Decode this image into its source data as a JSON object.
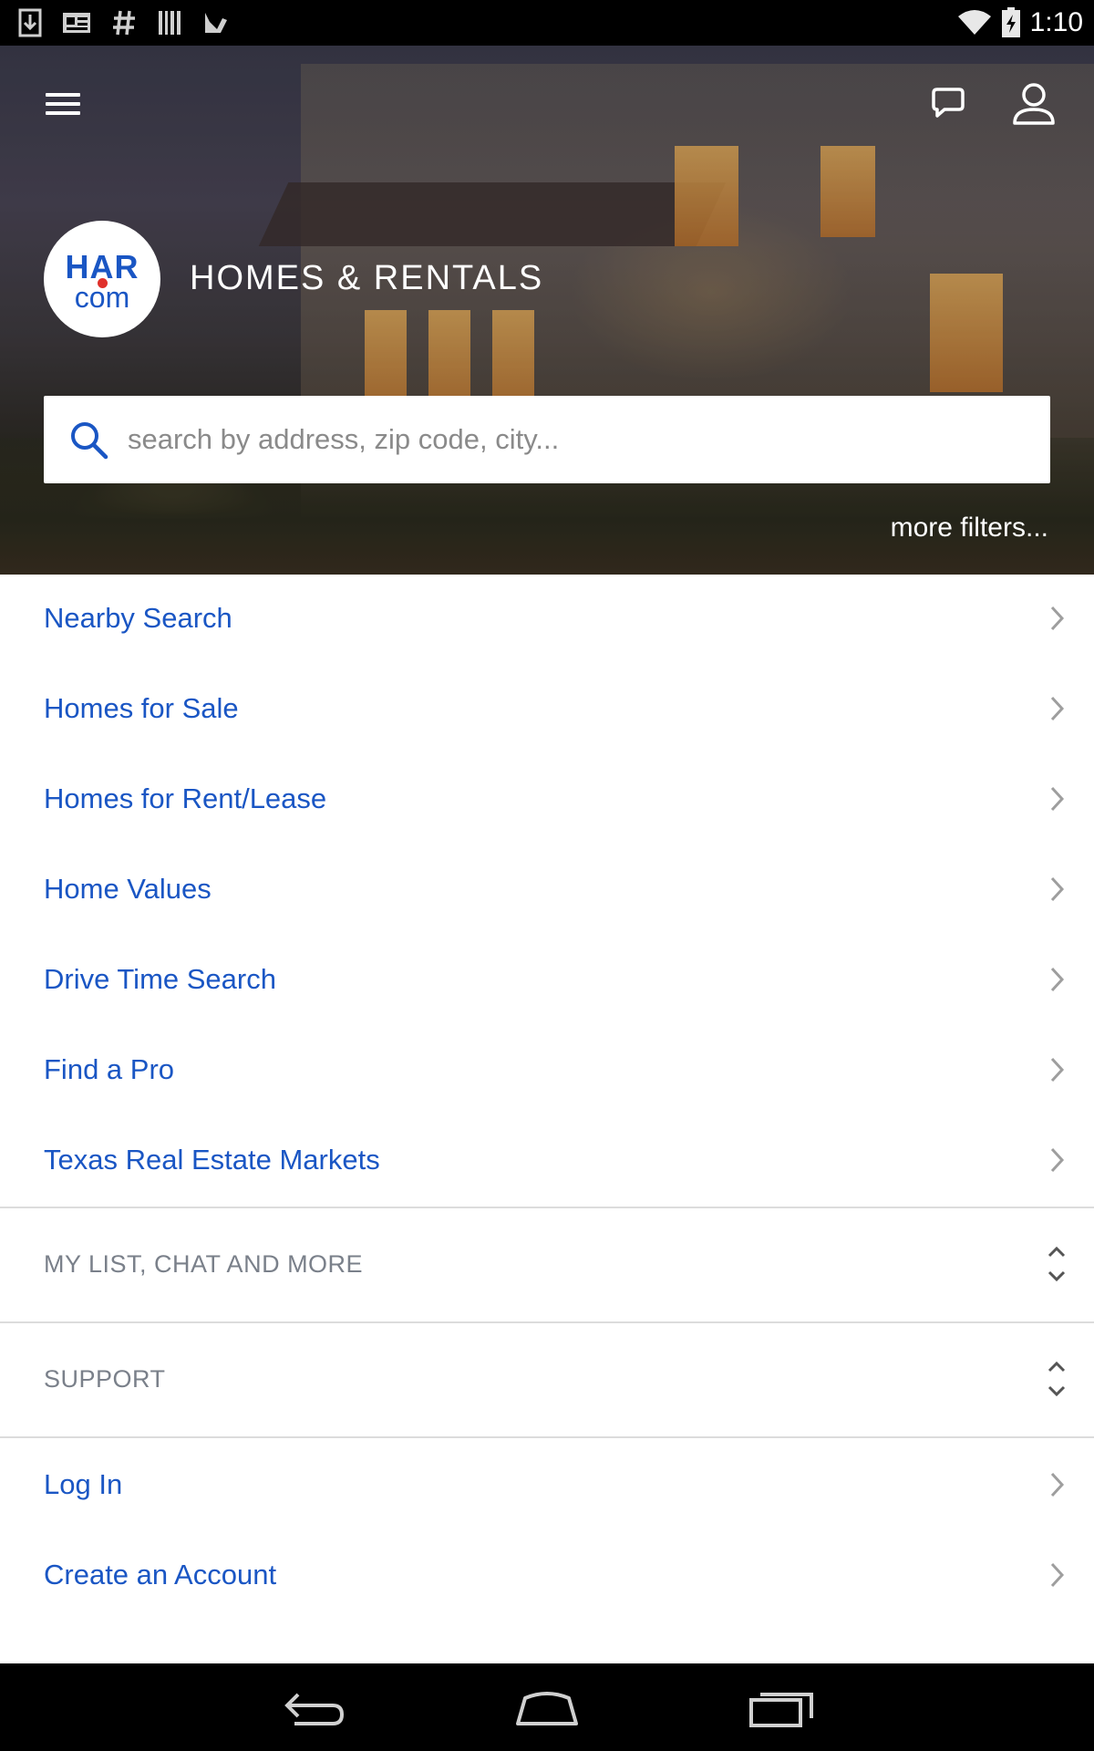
{
  "status_bar": {
    "time": "1:10",
    "left_icons": [
      "download-icon",
      "news-icon",
      "hash-icon",
      "barcode-icon",
      "play-store-icon"
    ],
    "right_icons": [
      "wifi-icon",
      "battery-charging-icon"
    ]
  },
  "header": {
    "title": "HOMES & RENTALS",
    "logo_top": "HAR",
    "logo_bottom": "com"
  },
  "search": {
    "placeholder": "search by address, zip code, city...",
    "more_filters": "more filters..."
  },
  "menu_items": [
    {
      "label": "Nearby Search"
    },
    {
      "label": "Homes for Sale"
    },
    {
      "label": "Homes for Rent/Lease"
    },
    {
      "label": "Home Values"
    },
    {
      "label": "Drive Time Search"
    },
    {
      "label": "Find a Pro"
    },
    {
      "label": "Texas Real Estate Markets"
    }
  ],
  "sections": [
    {
      "label": "MY LIST, CHAT AND MORE"
    },
    {
      "label": "SUPPORT"
    }
  ],
  "account_items": [
    {
      "label": "Log In"
    },
    {
      "label": "Create an Account"
    }
  ],
  "colors": {
    "link_blue": "#1a56c4",
    "section_grey": "#7a808a",
    "chevron_grey": "#9e9e9e",
    "logo_dot_red": "#e0312b"
  }
}
